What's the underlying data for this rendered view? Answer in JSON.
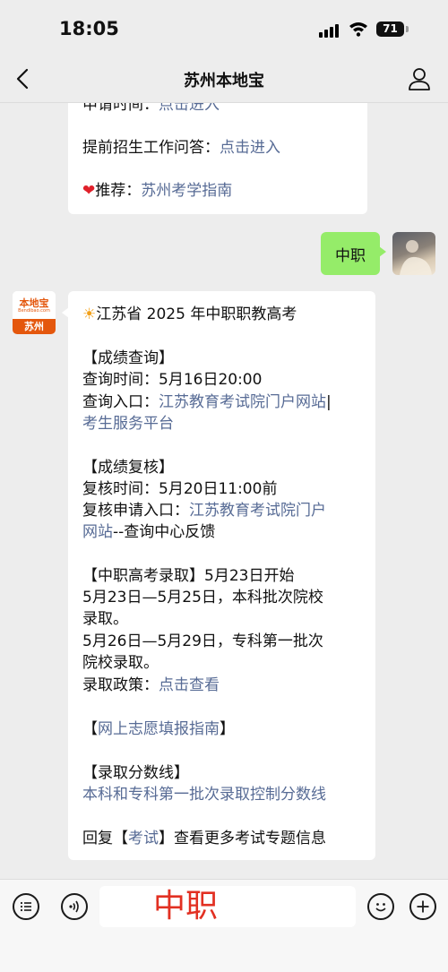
{
  "status_bar": {
    "time": "18:05",
    "battery": "71"
  },
  "nav": {
    "title": "苏州本地宝"
  },
  "earlier_message": {
    "partial_label": "申请时间：",
    "partial_link": "点击进入",
    "line2_label": "提前招生工作问答：",
    "line2_link": "点击进入",
    "line3_label": "推荐：",
    "line3_link": "苏州考学指南"
  },
  "user_message": {
    "text": "中职"
  },
  "bot": {
    "avatar_brand": "本地宝",
    "avatar_sub": "Bendibao.com",
    "avatar_city": "苏州",
    "heading": "江苏省 2025 年中职职教高考",
    "sec1_title": "【成绩查询】",
    "sec1_time": "查询时间：5月16日20:00",
    "sec1_entry_label": "查询入口：",
    "sec1_entry_link1": "江苏教育考试院门户网站",
    "sec1_entry_sep": "|",
    "sec1_entry_link2": "考生服务平台",
    "sec2_title": "【成绩复核】",
    "sec2_time": "复核时间：5月20日11:00前",
    "sec2_entry_label": "复核申请入口：",
    "sec2_entry_link_a": "江苏教育考试院门户",
    "sec2_entry_link_b": "网站",
    "sec2_entry_tail": "--查询中心反馈",
    "sec3_title": "【中职高考录取】5月23日开始",
    "sec3_line1": "5月23日—5月25日，本科批次院校",
    "sec3_line2": "录取。",
    "sec3_line3": "5月26日—5月29日，专科第一批次",
    "sec3_line4": "院校录取。",
    "sec3_policy_label": "录取政策：",
    "sec3_policy_link": "点击查看",
    "sec4_open": "【",
    "sec4_link": "网上志愿填报指南",
    "sec4_close": "】",
    "sec5_title": "【录取分数线】",
    "sec5_link": "本科和专科第一批次录取控制分数线",
    "footer_prefix": "回复【",
    "footer_link": "考试",
    "footer_suffix": "】查看更多考试专题信息"
  },
  "input_bar": {
    "value": "中职"
  },
  "colors": {
    "link": "#576b95",
    "green_bubble": "#95ec69",
    "background": "#ededed",
    "brand_orange": "#e4570d",
    "input_text": "#e23022"
  }
}
